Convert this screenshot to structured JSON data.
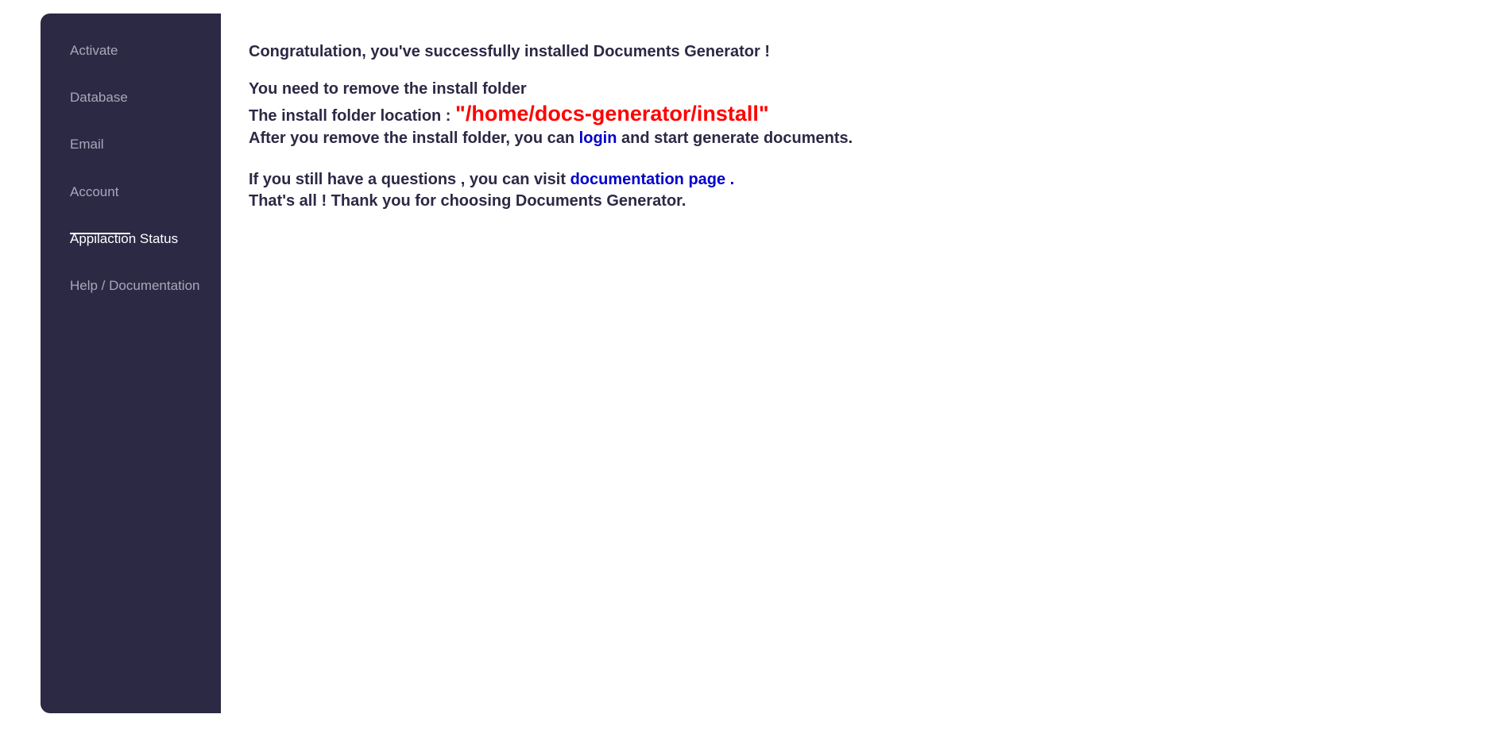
{
  "sidebar": {
    "items": [
      {
        "label": "Activate"
      },
      {
        "label": "Database"
      },
      {
        "label": "Email"
      },
      {
        "label": "Account"
      },
      {
        "label": "Appilaction Status"
      },
      {
        "label": "Help / Documentation"
      }
    ],
    "active_index": 4
  },
  "main": {
    "congrats": "Congratulation, you've successfully installed Documents Generator !",
    "remove_notice": "You need to remove the install folder",
    "location_label": "The install folder location :",
    "location_path": "\"/home/docs-generator/install\"",
    "after_prefix": "After you remove the install folder, you can",
    "login_link": "login",
    "after_suffix": "and start generate documents.",
    "questions_prefix": "If you still have a questions , you can visit",
    "docs_link": "documentation page .",
    "thanks": "That's all ! Thank you for choosing Documents Generator."
  },
  "colors": {
    "sidebar_bg": "#2c2945",
    "text": "#2c2945",
    "path": "#ff0000",
    "link": "#0000cc"
  }
}
